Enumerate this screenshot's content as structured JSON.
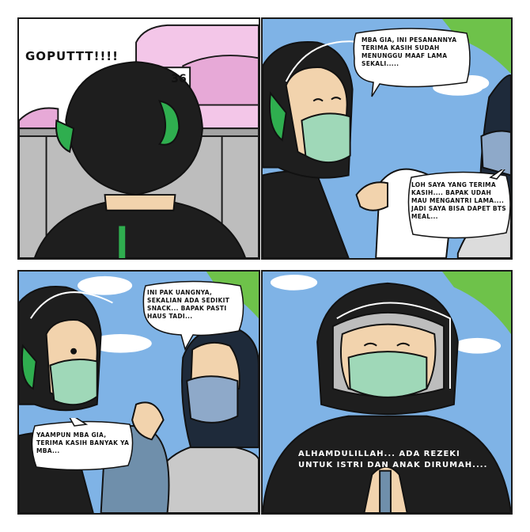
{
  "panels": {
    "p1": {
      "sound_effect": "GOPUTTT!!!!",
      "house_number": "36"
    },
    "p2": {
      "bubble_top": "MBA GIA, INI PESANANNYA TERIMA KASIH SUDAH MENUNGGU MAAF LAMA SEKALI.....",
      "bubble_bottom": "LOH SAYA YANG TERIMA KASIH.... BAPAK UDAH MAU MENGANTRI LAMA.... JADI SAYA BISA DAPET BTS MEAL..."
    },
    "p3": {
      "bubble_top": "INI PAK UANGNYA, SEKALIAN ADA SEDIKIT SNACK... BAPAK PASTI HAUS TADI...",
      "bubble_bottom": "YAAMPUN MBA GIA, TERIMA KASIH BANYAK YA MBA..."
    },
    "p4": {
      "caption": "ALHAMDULILLAH... ADA REZEKI UNTUK ISTRI DAN ANAK DIRUMAH...."
    }
  },
  "colors": {
    "sky": "#7fb3e6",
    "helmet": "#1e1e1e",
    "green_accent": "#2fae4f",
    "mask": "#9fd8b8",
    "skin": "#f2d3ad",
    "hijab": "#1e2a3a",
    "grey_mask": "#8ea9c9",
    "pink_house": "#f3c6e8",
    "leaf": "#6ec24a"
  }
}
